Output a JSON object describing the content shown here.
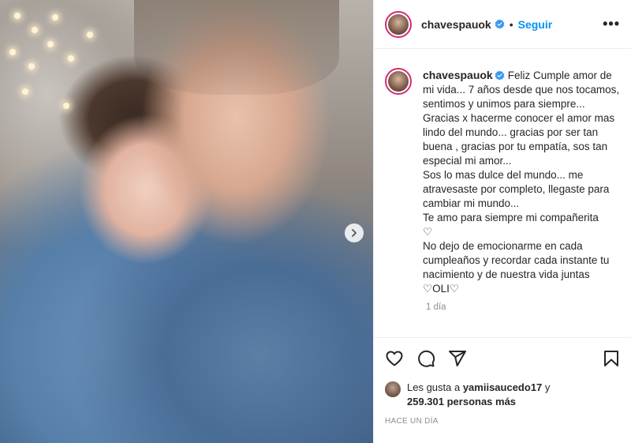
{
  "post": {
    "username": "chavespauok",
    "dot": "•",
    "follow_label": "Seguir",
    "more_label": "•••"
  },
  "caption": {
    "username": "chavespauok",
    "text": "Feliz Cumple amor de mi vida... 7 años desde que nos tocamos, sentimos y unimos para siempre...\nGracias x hacerme conocer el amor mas lindo del mundo... gracias por ser tan buena , gracias por tu empatía, sos tan especial mi amor...\nSos lo mas dulce del mundo... me atravesaste por completo, llegaste para cambiar mi mundo...\nTe amo para siempre mi compañerita\n♡\nNo dejo de emocionarme en cada cumpleaños y recordar cada instante tu nacimiento y de nuestra vida juntas\n♡OLI♡",
    "time": "1 día"
  },
  "likes": {
    "prefix": "Les gusta a ",
    "user": "yamiisaucedo17",
    "connector": " y",
    "count": "259.301 personas más"
  },
  "posted_ago": "HACE UN DÍA",
  "icons": [
    "heart-icon",
    "comment-icon",
    "share-icon",
    "bookmark-icon",
    "verified-badge-icon",
    "chevron-right-icon"
  ],
  "colors": {
    "follow": "#0095f6",
    "verified": "#3897f0",
    "avatar_ring": "#d62976",
    "muted": "#8e8e8e"
  }
}
